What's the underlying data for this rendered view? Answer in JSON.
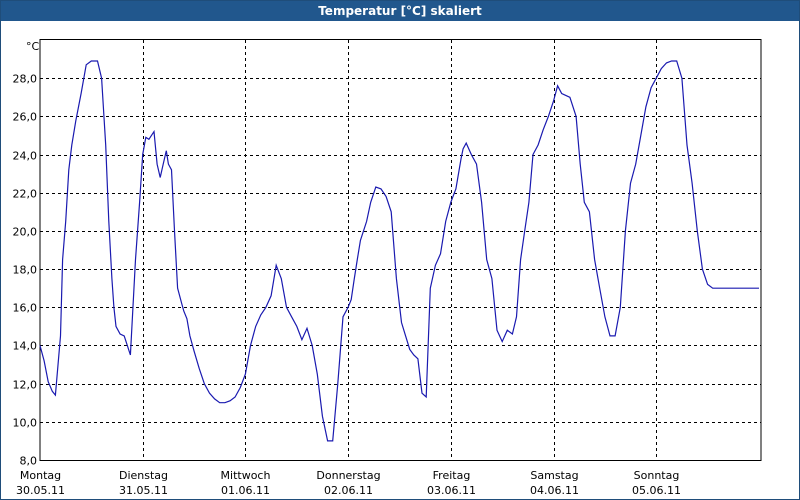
{
  "window": {
    "title": "Temperatur [°C] skaliert"
  },
  "chart_data": {
    "type": "line",
    "title": "Temperatur [°C] skaliert",
    "ylabel": "°C",
    "xlabel": "",
    "ylim": [
      8.0,
      30.0
    ],
    "y_ticks": [
      "8,0",
      "10,0",
      "12,0",
      "14,0",
      "16,0",
      "18,0",
      "20,0",
      "22,0",
      "24,0",
      "26,0",
      "28,0"
    ],
    "y_tick_values": [
      8,
      10,
      12,
      14,
      16,
      18,
      20,
      22,
      24,
      26,
      28
    ],
    "xlim": [
      0,
      7
    ],
    "x_ticks": [
      {
        "day": "Montag",
        "date": "30.05.11"
      },
      {
        "day": "Dienstag",
        "date": "31.05.11"
      },
      {
        "day": "Mittwoch",
        "date": "01.06.11"
      },
      {
        "day": "Donnerstag",
        "date": "02.06.11"
      },
      {
        "day": "Freitag",
        "date": "03.06.11"
      },
      {
        "day": "Samstag",
        "date": "04.06.11"
      },
      {
        "day": "Sonntag",
        "date": "05.06.11"
      }
    ],
    "grid": true,
    "series_color": "#1a1ab0",
    "series": [
      {
        "x": [
          0.0,
          0.04,
          0.08,
          0.12,
          0.15,
          0.2,
          0.22,
          0.25,
          0.28,
          0.31,
          0.35,
          0.4,
          0.45,
          0.5,
          0.56,
          0.6,
          0.64,
          0.67,
          0.7,
          0.72,
          0.74,
          0.78,
          0.82,
          0.88,
          0.93,
          0.97,
          1.0,
          1.03,
          1.06,
          1.11,
          1.14,
          1.17,
          1.2,
          1.23,
          1.25,
          1.28,
          1.31,
          1.34,
          1.38,
          1.4,
          1.43,
          1.46,
          1.5,
          1.55,
          1.6,
          1.65,
          1.7,
          1.75,
          1.8,
          1.85,
          1.9,
          1.95,
          2.0,
          2.05,
          2.1,
          2.15,
          2.2,
          2.25,
          2.3,
          2.35,
          2.4,
          2.45,
          2.5,
          2.55,
          2.6,
          2.65,
          2.7,
          2.75,
          2.8,
          2.85,
          2.9,
          2.95,
          3.0,
          3.03,
          3.06,
          3.09,
          3.12,
          3.15,
          3.18,
          3.22,
          3.27,
          3.32,
          3.37,
          3.42,
          3.47,
          3.52,
          3.56,
          3.6,
          3.64,
          3.68,
          3.72,
          3.76,
          3.8,
          3.85,
          3.9,
          3.95,
          4.0,
          4.05,
          4.1,
          4.12,
          4.15,
          4.2,
          4.25,
          4.3,
          4.35,
          4.4,
          4.45,
          4.5,
          4.55,
          4.6,
          4.64,
          4.68,
          4.72,
          4.76,
          4.8,
          4.85,
          4.9,
          4.95,
          5.0,
          5.04,
          5.08,
          5.12,
          5.16,
          5.22,
          5.26,
          5.3,
          5.35,
          5.4,
          5.45,
          5.5,
          5.55,
          5.6,
          5.65,
          5.7,
          5.75,
          5.8,
          5.85,
          5.9,
          5.95,
          6.0,
          6.05,
          6.1,
          6.15,
          6.2,
          6.25,
          6.3,
          6.35,
          6.4,
          6.45,
          6.5,
          6.55,
          6.6,
          6.65,
          6.7,
          6.75,
          6.8,
          6.85,
          6.9,
          6.95,
          7.0,
          7.05
        ],
        "y": [
          14.0,
          13.2,
          12.1,
          11.6,
          11.4,
          14.5,
          18.5,
          20.5,
          23.2,
          24.5,
          25.8,
          27.2,
          28.7,
          28.9,
          28.9,
          28.0,
          24.5,
          20.5,
          17.5,
          16.0,
          15.0,
          14.6,
          14.5,
          13.5,
          18.5,
          21.5,
          24.0,
          24.9,
          24.8,
          25.2,
          23.5,
          22.8,
          23.5,
          24.2,
          23.5,
          23.2,
          20.0,
          17.0,
          16.2,
          15.8,
          15.4,
          14.5,
          13.7,
          12.8,
          12.0,
          11.5,
          11.2,
          11.0,
          11.0,
          11.1,
          11.3,
          11.8,
          12.5,
          14.0,
          15.0,
          15.6,
          16.0,
          16.6,
          18.2,
          17.5,
          16.0,
          15.5,
          15.0,
          14.3,
          14.9,
          14.0,
          12.5,
          10.3,
          9.0,
          9.0,
          12.0,
          15.5,
          16.0,
          16.4,
          17.5,
          18.5,
          19.5,
          20.0,
          20.5,
          21.5,
          22.3,
          22.2,
          21.8,
          21.0,
          17.5,
          15.2,
          14.5,
          13.8,
          13.5,
          13.3,
          11.5,
          11.3,
          17.0,
          18.2,
          18.8,
          20.5,
          21.5,
          22.2,
          23.8,
          24.3,
          24.6,
          24.0,
          23.5,
          21.5,
          18.5,
          17.5,
          14.8,
          14.2,
          14.8,
          14.6,
          15.5,
          18.5,
          20.0,
          21.5,
          24.0,
          24.5,
          25.3,
          26.0,
          26.8,
          27.6,
          27.2,
          27.1,
          27.0,
          26.0,
          23.5,
          21.5,
          21.0,
          18.5,
          17.0,
          15.5,
          14.5,
          14.5,
          16.0,
          20.0,
          22.5,
          23.5,
          25.0,
          26.5,
          27.5,
          28.0,
          28.5,
          28.8,
          28.9,
          28.9,
          28.0,
          24.5,
          22.5,
          20.0,
          18.0,
          17.2,
          17.0,
          17.0,
          17.0,
          17.0,
          17.0,
          17.0,
          17.0,
          17.0,
          17.0,
          17.0,
          17.0
        ]
      }
    ]
  }
}
